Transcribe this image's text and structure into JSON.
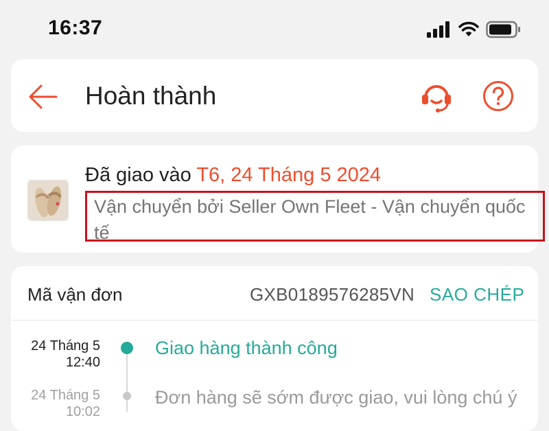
{
  "status_bar": {
    "time": "16:37",
    "icons": [
      "cellular-signal-icon",
      "wifi-icon",
      "battery-icon"
    ]
  },
  "header": {
    "title": "Hoàn thành",
    "icons": [
      "back-arrow-icon",
      "headset-support-icon",
      "help-question-icon"
    ]
  },
  "delivery": {
    "delivered_prefix": "Đã giao vào ",
    "delivered_date": "T6, 24 Tháng 5 2024",
    "carrier_text": "Vận chuyển bởi Seller Own Fleet - Vận chuyển quốc tế"
  },
  "tracking": {
    "label": "Mã vận đơn",
    "number": "GXB0189576285VN",
    "copy_label": "SAO CHÉP"
  },
  "events": [
    {
      "date": "24 Tháng 5",
      "time": "12:40",
      "text": "Giao hàng thành công"
    },
    {
      "date": "24 Tháng 5",
      "time": "10:02",
      "text": "Đơn hàng sẽ sớm được giao, vui lòng chú ý"
    }
  ],
  "colors": {
    "accent": "#ee4d2d",
    "success": "#26aa99",
    "highlight_border": "#c8101c",
    "background": "#f2f2f2"
  }
}
